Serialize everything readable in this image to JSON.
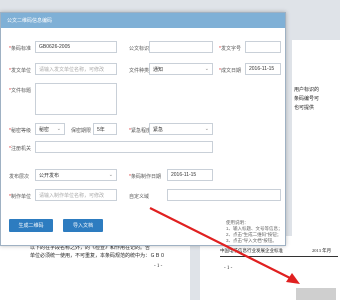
{
  "background": {
    "right_text": [
      "用户标识的",
      "条码编号可",
      "也可提供"
    ],
    "bottom_left_text": [
      "以下的在字段名称之外，的《检查》和作用在记的。告",
      "单位必须统一使用，不可重复，本条码规范的统中为：ＧＢ０",
      "- 1 -"
    ],
    "bottom_right_header": "中国电子信息行业发展企业标准",
    "bottom_right_year": "2013 年月",
    "bottom_right_page": "- 1 -"
  },
  "dialog": {
    "title": "公文二维码信息编码",
    "fields": {
      "code_std_label": "条码标准",
      "code_std_value": "GB0626-2005",
      "doc_id_label": "公文标识",
      "doc_id_value": "",
      "doc_number_label": "发文字号",
      "doc_number_value": "",
      "issuer_label": "发文单位",
      "issuer_placeholder": "请输入发文单位名称，可修改",
      "doc_type_label": "文件种类",
      "doc_type_value": "通知",
      "issue_date_label": "成文日期",
      "issue_date_value": "2016-11-15",
      "doc_title_label": "文件标题",
      "secret_label": "秘密等级",
      "secret_value": "秘密",
      "secret_term_label": "保密期限",
      "secret_term_value": "5年",
      "urgency_label": "紧急程度",
      "urgency_value": "紧急",
      "annot_label": "注册机关",
      "publish_scope_label": "发布层次",
      "publish_scope_value": "公开发布",
      "create_date_label": "条码制作日期",
      "create_date_value": "2016-11-15",
      "producer_label": "制作单位",
      "producer_placeholder": "请输入制作单位名称，可修改",
      "volume_label": "自定义域"
    },
    "buttons": {
      "generate": "生成二维码",
      "import": "导入文档"
    },
    "help": {
      "title": "使用说明：",
      "lines": [
        "1、输入标题、文号等信息；",
        "2、点击\"生成二维码\"按钮；",
        "3、点击\"导入文档\"按钮。"
      ]
    }
  }
}
